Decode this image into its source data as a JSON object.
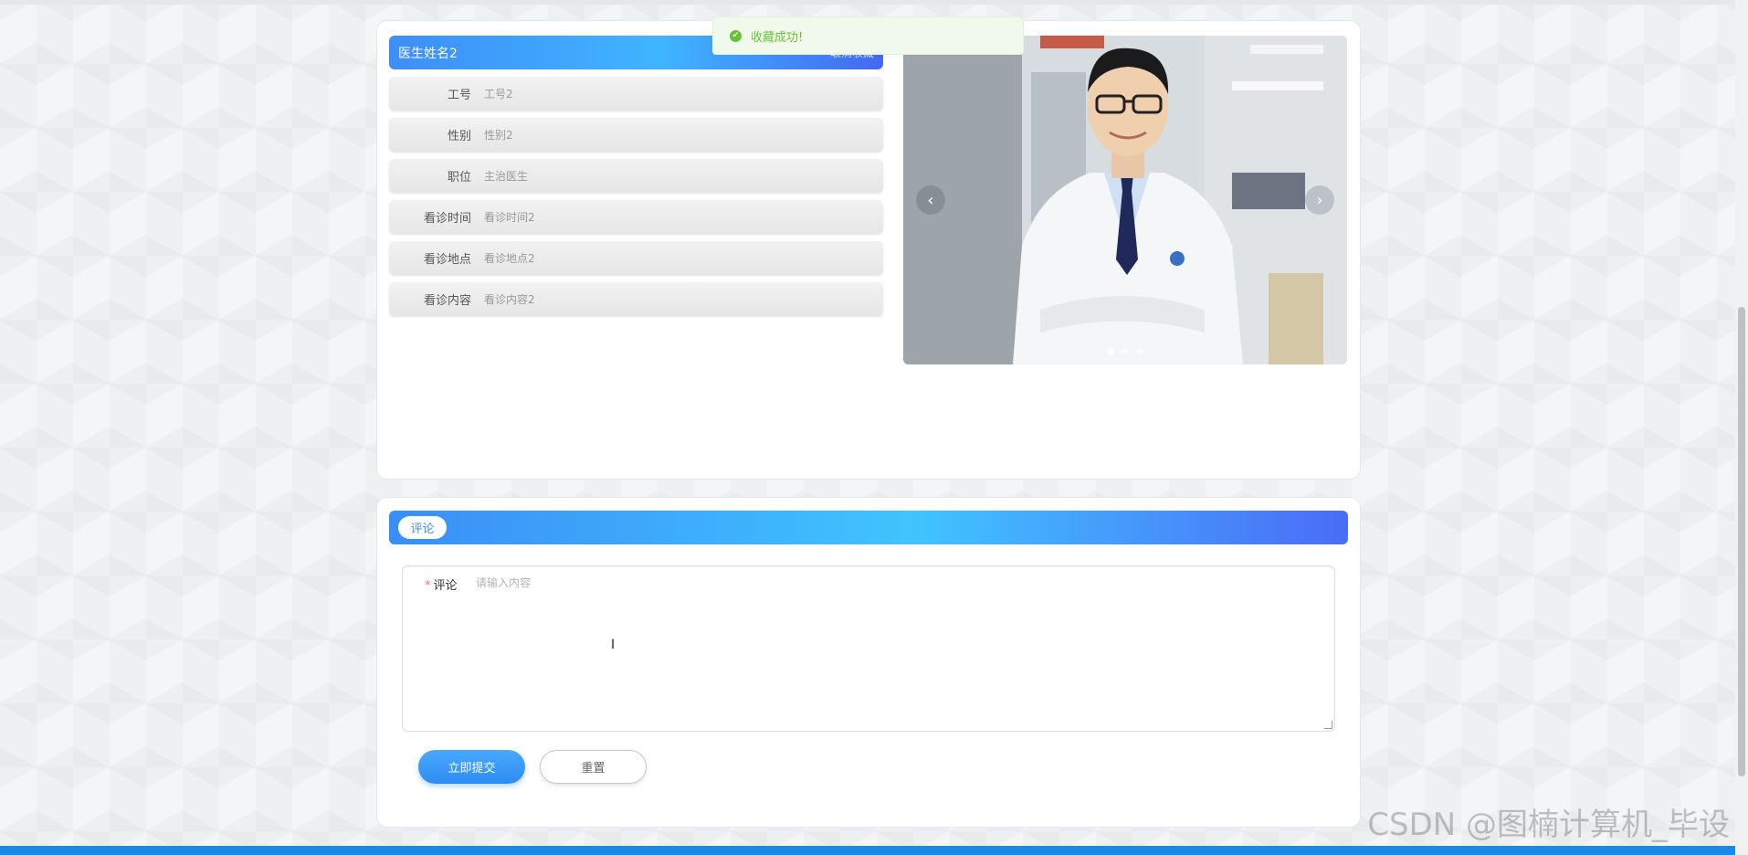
{
  "toast": {
    "message": "收藏成功!",
    "icon": "check-circle-icon",
    "color": "#67c23a"
  },
  "doctor": {
    "name": "医生姓名2",
    "favorite_label": "取消收藏",
    "fields": [
      {
        "label": "工号",
        "value": "工号2"
      },
      {
        "label": "性别",
        "value": "性别2"
      },
      {
        "label": "职位",
        "value": "主治医生"
      },
      {
        "label": "看诊时间",
        "value": "看诊时间2"
      },
      {
        "label": "看诊地点",
        "value": "看诊地点2"
      },
      {
        "label": "看诊内容",
        "value": "看诊内容2"
      }
    ]
  },
  "carousel": {
    "prev_symbol": "‹",
    "next_symbol": "›",
    "slide_count": 3,
    "active_index": 0
  },
  "comment": {
    "tag": "评论",
    "field_label": "评论",
    "required_mark": "*",
    "placeholder": "请输入内容",
    "value": "",
    "submit_label": "立即提交",
    "reset_label": "重置"
  },
  "watermark": "CSDN @图楠计算机_毕设",
  "colors": {
    "accent": "#2d8cf0",
    "bottom_bar": "#1e88e5",
    "success": "#67c23a"
  }
}
